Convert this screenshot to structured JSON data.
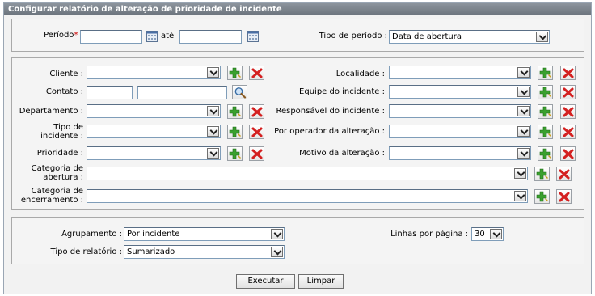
{
  "title": "Configurar relatório de alteração de prioridade de incidente",
  "period": {
    "label": "Período",
    "required_mark": "*",
    "separator": ":",
    "until": "até",
    "type_label": "Tipo de período :",
    "type_value": "Data de abertura"
  },
  "filters": {
    "cliente": "Cliente :",
    "contato": "Contato :",
    "departamento": "Departamento :",
    "tipo_line1": "Tipo de",
    "tipo_line2": "incidente :",
    "prioridade": "Prioridade :",
    "localidade": "Localidade :",
    "equipe": "Equipe do incidente :",
    "responsavel": "Responsável do incidente :",
    "operador": "Por operador da alteração :",
    "motivo": "Motivo da alteração :",
    "cat_abertura_line1": "Categoria de",
    "cat_abertura_line2": "abertura :",
    "cat_encerramento_line1": "Categoria de",
    "cat_encerramento_line2": "encerramento :"
  },
  "options": {
    "agrupamento_label": "Agrupamento :",
    "agrupamento_value": "Por incidente",
    "tipo_relatorio_label": "Tipo de relatório :",
    "tipo_relatorio_value": "Sumarizado",
    "linhas_label": "Linhas por página :",
    "linhas_value": "30"
  },
  "actions": {
    "executar": "Executar",
    "limpar": "Limpar"
  },
  "colors": {
    "add_icon": "#3aa02e",
    "remove_icon": "#d42020",
    "title_bar": "#7b838c"
  }
}
